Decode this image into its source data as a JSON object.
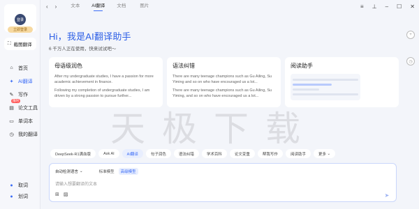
{
  "sidebar": {
    "user": {
      "avatar_label": "登录",
      "login_pill": "立即登录"
    },
    "screenshot_label": "截图翻译",
    "items": [
      {
        "label": "首页"
      },
      {
        "label": "AI翻译"
      },
      {
        "label": "写作"
      },
      {
        "label": "论文工具",
        "badge": "限时"
      },
      {
        "label": "单词本"
      },
      {
        "label": "我的翻译"
      }
    ],
    "bottom_items": [
      {
        "label": "取词"
      },
      {
        "label": "划词"
      }
    ]
  },
  "topbar": {
    "tabs": [
      "文本",
      "AI翻译",
      "文档",
      "图片"
    ],
    "active_tab": "AI翻译"
  },
  "hero": {
    "title": "Hi，我是AI翻译助手",
    "subtitle": "6 千万人正在使用，快来试试吧～"
  },
  "cards": [
    {
      "title": "母语级润色",
      "p1": "After my undergraduate studies, I have a passion for more academic achievement in finance.",
      "p2": "Following my completion of undergraduate studies, I am driven by a strong passion to pursue further..."
    },
    {
      "title": "语法纠错",
      "p1": "There are many teenage champions such as Gu Ailing, Su Yiming and so on who have encouraged us a lot...",
      "p2": "There are many teenage champions such as Gu Ailing, Su Yiming, and so on who have encouraged us a lot..."
    },
    {
      "title": "阅读助手"
    }
  ],
  "watermark": "天极下载",
  "chips": [
    "DeepSeek-R1满血版",
    "Ask AI",
    "AI翻译",
    "句子润色",
    "语法纠错",
    "学术百科",
    "论文变重",
    "帮我写作",
    "阅读助手",
    "更多"
  ],
  "active_chip": "AI翻译",
  "composer": {
    "lang": "自动检测语言",
    "modes": [
      "标准模型",
      "高级模型"
    ],
    "active_mode": "高级模型",
    "placeholder": "请输入想要翻译的文本"
  },
  "colors": {
    "accent": "#3b6cf6",
    "title": "#2d5fe6"
  }
}
